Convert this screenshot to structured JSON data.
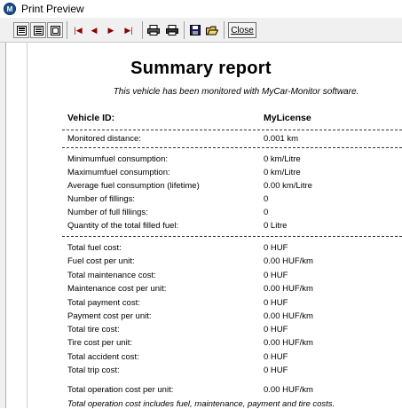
{
  "window": {
    "title": "Print Preview"
  },
  "toolbar": {
    "close_label": "Close",
    "icons": [
      "page-view-icon",
      "list-view-icon",
      "fit-view-icon",
      "first-page-icon",
      "prev-page-icon",
      "next-page-icon",
      "last-page-icon",
      "print-setup-icon",
      "print-icon",
      "save-icon",
      "open-icon"
    ]
  },
  "report": {
    "title": "Summary report",
    "subtitle": "This vehicle  has been monitored with MyCar-Monitor software.",
    "header": {
      "label": "Vehicle ID:",
      "value": "MyLicense"
    },
    "distance": {
      "label": "Monitored distance:",
      "value": "0.001 km"
    },
    "consumption": [
      {
        "label": "Minimumfuel consumption:",
        "value": "0 km/Litre"
      },
      {
        "label": "Maximumfuel consumption:",
        "value": "0 km/Litre"
      },
      {
        "label": "Average fuel consumption (lifetime)",
        "value": "0.00 km/Litre"
      },
      {
        "label": "Number of fillings:",
        "value": "0"
      },
      {
        "label": "Number of full fillings:",
        "value": "0"
      },
      {
        "label": "Quantity of the total filled fuel:",
        "value": "0 Litre"
      }
    ],
    "costs": [
      {
        "label": "Total fuel cost:",
        "value": "0 HUF"
      },
      {
        "label": "Fuel cost per unit:",
        "value": "0.00 HUF/km"
      },
      {
        "label": "Total maintenance cost:",
        "value": "0 HUF"
      },
      {
        "label": "Maintenance cost per unit:",
        "value": "0.00 HUF/km"
      },
      {
        "label": "Total payment cost:",
        "value": "0 HUF"
      },
      {
        "label": "Payment cost per unit:",
        "value": "0.00 HUF/km"
      },
      {
        "label": "Total tire cost:",
        "value": "0 HUF"
      },
      {
        "label": "Tire cost per unit:",
        "value": "0.00 HUF/km"
      },
      {
        "label": "Total accident cost:",
        "value": "0 HUF"
      },
      {
        "label": "Total trip cost:",
        "value": "0 HUF"
      }
    ],
    "operation": {
      "label": "Total operation cost per unit:",
      "value": "0.00 HUF/km"
    },
    "note": "Total operation cost includes fuel, maintenance, payment and tire costs."
  }
}
